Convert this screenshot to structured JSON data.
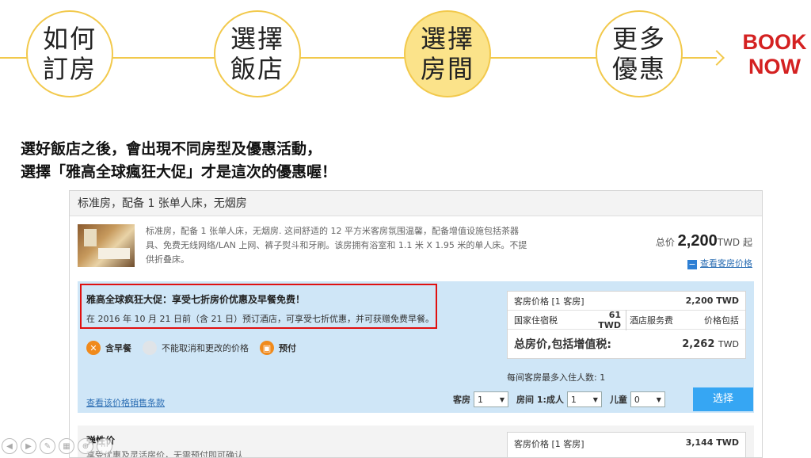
{
  "steps": [
    {
      "line1": "如何",
      "line2": "訂房"
    },
    {
      "line1": "選擇",
      "line2": "飯店"
    },
    {
      "line1": "選擇",
      "line2": "房間"
    },
    {
      "line1": "更多",
      "line2": "優惠"
    }
  ],
  "book_now": {
    "line1": "BOOK",
    "line2": "NOW"
  },
  "caption": {
    "line1": "選好飯店之後，會出現不同房型及優惠活動，",
    "line2": "選擇「雅高全球瘋狂大促」才是這次的優惠喔！"
  },
  "room": {
    "title": "标准房，配备 1 张单人床，无烟房",
    "description_1": "标准房，配备 1 张单人床，无烟房. 这间舒适的 12 平方米客房氛围温馨，配备增值设施包括茶器",
    "description_2": "具、免费无线网络/LAN 上网、裤子熨斗和牙刷。该房拥有浴室和 1.1 米 X 1.95 米的单人床。不提",
    "description_3": "供折叠床。",
    "total_prefix": "总价",
    "price": "2,200",
    "price_suffix": "TWD 起",
    "view_prices": "查看客房价格",
    "minus": "−"
  },
  "deal": {
    "title": "雅高全球疯狂大促：享受七折房价优惠及早餐免费！",
    "subtitle": "在 2016 年 10 月 21 日前（含 21 日）预订酒店，可享受七折优惠，并可获赠免费早餐。",
    "feature_breakfast": "含早餐",
    "feature_nocancel": "不能取消和更改的价格",
    "feature_prepay": "预付",
    "breakdown": {
      "room_label": "客房价格 [1 客房]",
      "room_value": "2,200 TWD",
      "tax_label": "国家住宿税",
      "tax_value": "61 TWD",
      "service_label": "酒店服务费",
      "service_value": "价格包括",
      "total_label": "总房价,包括增值税:",
      "total_value": "2,262",
      "total_unit": "TWD"
    },
    "max_occupancy": "每间客房最多入住人数: 1",
    "terms_link": "查看该价格销售条款",
    "rooms_label": "客房",
    "rooms_value": "1",
    "adults_label": "房间 1:成人",
    "adults_value": "1",
    "children_label": "儿童",
    "children_value": "0",
    "select_button": "选择"
  },
  "flexible": {
    "title": "弹性价",
    "subtitle": "享受优惠及灵活房价，无需预付即可确认",
    "room_label": "客房价格 [1 客房]",
    "room_value": "3,144 TWD"
  },
  "colors": {
    "accent_yellow": "#f2c94c",
    "active_step": "#fbe38a",
    "book_red": "#d42121",
    "deal_blue": "#cfe6f7",
    "highlight_red": "#e01010",
    "button_blue": "#36a6f3"
  }
}
